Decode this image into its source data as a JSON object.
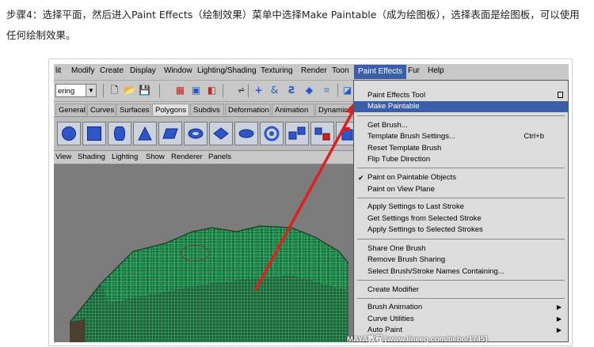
{
  "caption": "步骤4：选择平面，然后进入Paint Effects（绘制效果）菜单中选择Make Paintable（成为绘图板），选择表面是绘图板，可以使用任何绘制效果。",
  "menubar": [
    "lit",
    "Modify",
    "Create",
    "Display",
    "Window",
    "Lighting/Shading",
    "Texturing",
    "Render",
    "Toon",
    "Paint Effects",
    "Fur",
    "Help"
  ],
  "mode_selector": "ering",
  "shelf_tabs": [
    "General",
    "Curves",
    "Surfaces",
    "Polygons",
    "Subdivs",
    "Deformation",
    "Animation",
    "Dynamics"
  ],
  "active_shelf_tab": "Polygons",
  "panel_menu": [
    "View",
    "Shading",
    "Lighting",
    "Show",
    "Renderer",
    "Panels"
  ],
  "dropdown": {
    "items": [
      {
        "label": "Paint Effects Tool",
        "option_box": true
      },
      {
        "label": "Make Paintable",
        "highlight": true
      },
      {
        "label": "Get Brush..."
      },
      {
        "label": "Template Brush Settings...",
        "shortcut": "Ctrl+b"
      },
      {
        "label": "Reset Template Brush"
      },
      {
        "label": "Flip Tube Direction"
      },
      {
        "label": "Paint on Paintable Objects",
        "checked": true
      },
      {
        "label": "Paint on View Plane"
      },
      {
        "label": "Apply Settings to Last Stroke"
      },
      {
        "label": "Get Settings from Selected Stroke"
      },
      {
        "label": "Apply Settings to Selected Strokes"
      },
      {
        "label": "Share One Brush"
      },
      {
        "label": "Remove Brush Sharing"
      },
      {
        "label": "Select Brush/Stroke Names Containing..."
      },
      {
        "label": "Create Modifier"
      },
      {
        "label": "Brush Animation",
        "submenu": true
      },
      {
        "label": "Curve Utilities",
        "submenu": true
      },
      {
        "label": "Auto Paint",
        "submenu": true
      }
    ]
  },
  "watermark": "MAYA教程  [www.lineeg.com/tiebo/1745]",
  "colors": {
    "highlight": "#3a5fa8",
    "mesh": "#3ddc84",
    "arrow": "#e02020"
  }
}
